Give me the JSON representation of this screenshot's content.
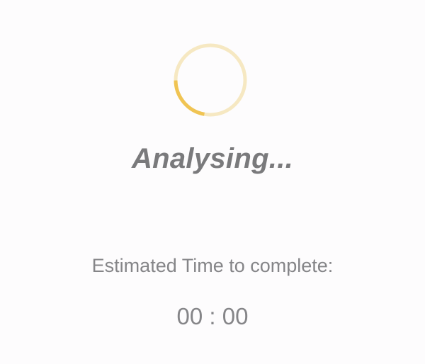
{
  "status": {
    "title": "Analysing...",
    "progress_fraction": 0.22,
    "spinner_track_color": "#f6e8c2",
    "spinner_arc_color": "#f0c453"
  },
  "estimate": {
    "label": "Estimated Time to complete:",
    "time": "00 : 00"
  }
}
